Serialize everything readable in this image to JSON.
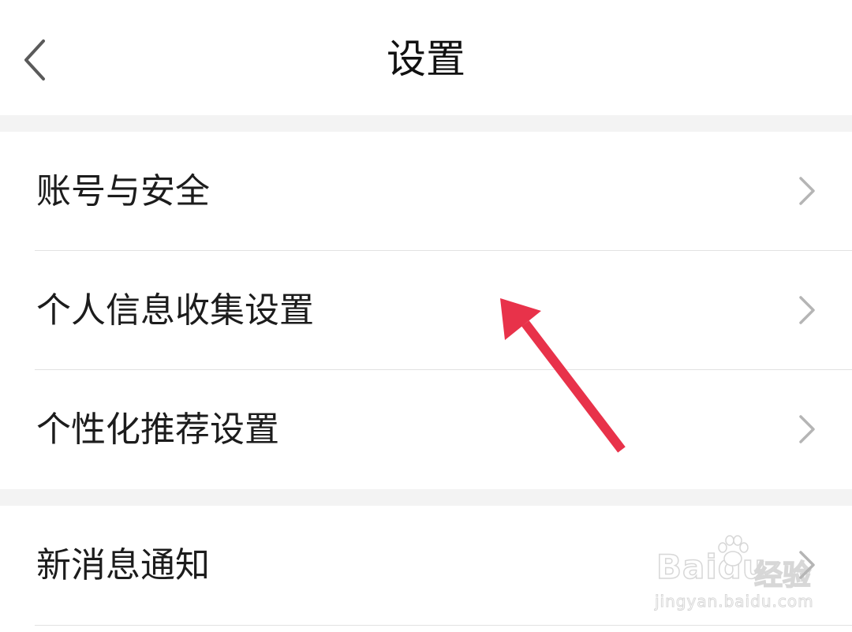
{
  "header": {
    "title": "设置",
    "back_icon": "chevron-left-icon"
  },
  "groups": [
    {
      "items": [
        {
          "label": "账号与安全",
          "icon": "chevron-right-icon"
        },
        {
          "label": "个人信息收集设置",
          "icon": "chevron-right-icon"
        },
        {
          "label": "个性化推荐设置",
          "icon": "chevron-right-icon"
        }
      ]
    },
    {
      "items": [
        {
          "label": "新消息通知",
          "icon": "chevron-right-icon"
        }
      ]
    }
  ],
  "annotation": {
    "type": "arrow",
    "color": "#e8324a",
    "points_to": "个人信息收集设置"
  },
  "watermark": {
    "brand": "Baidu",
    "brand_cn": "经验",
    "url": "jingyan.baidu.com"
  },
  "colors": {
    "background": "#f3f3f3",
    "surface": "#ffffff",
    "text": "#1c1c1c",
    "chevron": "#b5b5b5",
    "divider": "#e2e2e2"
  }
}
